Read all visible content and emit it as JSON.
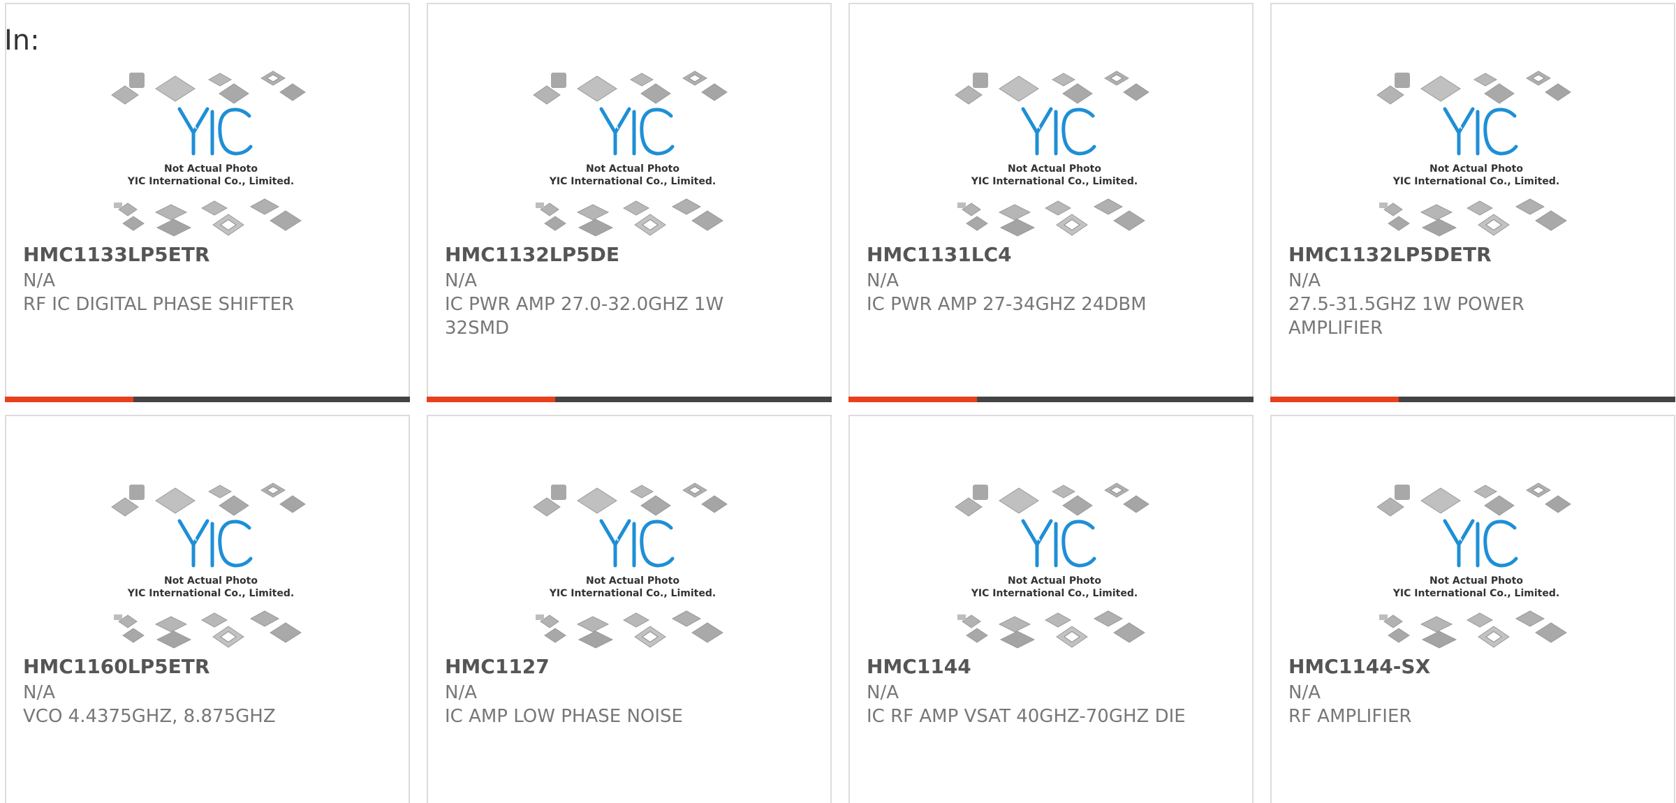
{
  "header": {
    "label": "In:"
  },
  "colors": {
    "accent": "#e8401c",
    "dark": "#444444",
    "logo": "#1e8fd6"
  },
  "placeholder": {
    "line1": "Not Actual Photo",
    "line2": "YIC International Co., Limited."
  },
  "products": [
    {
      "part_number": "HMC1133LP5ETR",
      "manufacturer": "N/A",
      "description": "RF IC DIGITAL PHASE SHIFTER"
    },
    {
      "part_number": "HMC1132LP5DE",
      "manufacturer": "N/A",
      "description": "IC PWR AMP 27.0-32.0GHZ 1W 32SMD"
    },
    {
      "part_number": "HMC1131LC4",
      "manufacturer": "N/A",
      "description": "IC PWR AMP 27-34GHZ 24DBM"
    },
    {
      "part_number": "HMC1132LP5DETR",
      "manufacturer": "N/A",
      "description": "27.5-31.5GHZ 1W POWER AMPLIFIER"
    },
    {
      "part_number": "HMC1160LP5ETR",
      "manufacturer": "N/A",
      "description": "VCO 4.4375GHZ, 8.875GHZ"
    },
    {
      "part_number": "HMC1127",
      "manufacturer": "N/A",
      "description": "IC AMP LOW PHASE NOISE"
    },
    {
      "part_number": "HMC1144",
      "manufacturer": "N/A",
      "description": "IC RF AMP VSAT 40GHZ-70GHZ DIE"
    },
    {
      "part_number": "HMC1144-SX",
      "manufacturer": "N/A",
      "description": "RF AMPLIFIER"
    }
  ]
}
